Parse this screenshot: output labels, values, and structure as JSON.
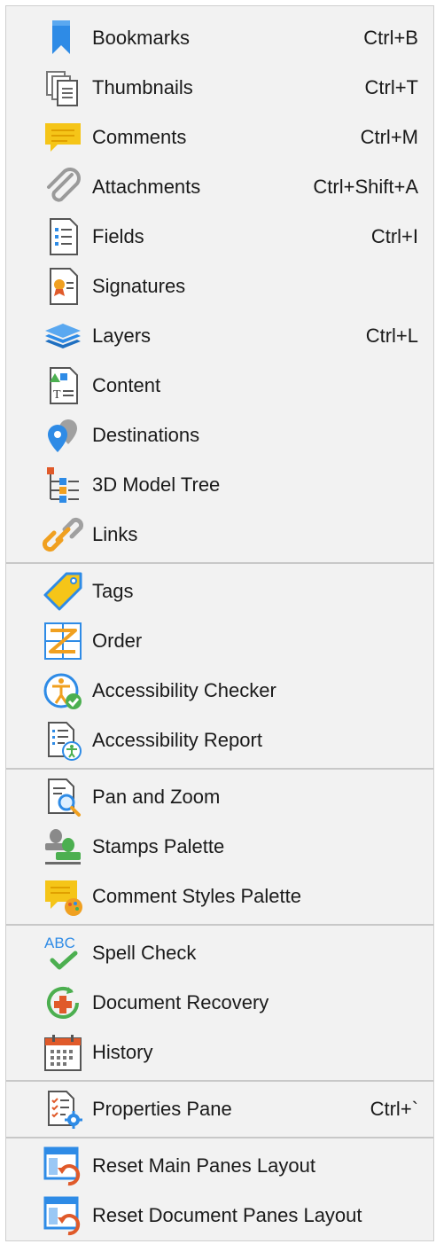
{
  "menu": {
    "items": [
      {
        "label": "Bookmarks",
        "shortcut": "Ctrl+B",
        "icon": "bookmark-icon"
      },
      {
        "label": "Thumbnails",
        "shortcut": "Ctrl+T",
        "icon": "thumbnails-icon"
      },
      {
        "label": "Comments",
        "shortcut": "Ctrl+M",
        "icon": "comment-icon"
      },
      {
        "label": "Attachments",
        "shortcut": "Ctrl+Shift+A",
        "icon": "paperclip-icon"
      },
      {
        "label": "Fields",
        "shortcut": "Ctrl+I",
        "icon": "fields-icon"
      },
      {
        "label": "Signatures",
        "shortcut": "",
        "icon": "signature-icon"
      },
      {
        "label": "Layers",
        "shortcut": "Ctrl+L",
        "icon": "layers-icon"
      },
      {
        "label": "Content",
        "shortcut": "",
        "icon": "content-icon"
      },
      {
        "label": "Destinations",
        "shortcut": "",
        "icon": "destinations-icon"
      },
      {
        "label": "3D Model Tree",
        "shortcut": "",
        "icon": "model-tree-icon"
      },
      {
        "label": "Links",
        "shortcut": "",
        "icon": "links-icon"
      },
      {
        "label": "Tags",
        "shortcut": "",
        "icon": "tag-icon"
      },
      {
        "label": "Order",
        "shortcut": "",
        "icon": "order-icon"
      },
      {
        "label": "Accessibility Checker",
        "shortcut": "",
        "icon": "accessibility-checker-icon"
      },
      {
        "label": "Accessibility Report",
        "shortcut": "",
        "icon": "accessibility-report-icon"
      },
      {
        "label": "Pan and Zoom",
        "shortcut": "",
        "icon": "pan-zoom-icon"
      },
      {
        "label": "Stamps Palette",
        "shortcut": "",
        "icon": "stamps-icon"
      },
      {
        "label": "Comment Styles Palette",
        "shortcut": "",
        "icon": "comment-styles-icon"
      },
      {
        "label": "Spell Check",
        "shortcut": "",
        "icon": "spell-check-icon"
      },
      {
        "label": "Document Recovery",
        "shortcut": "",
        "icon": "document-recovery-icon"
      },
      {
        "label": "History",
        "shortcut": "",
        "icon": "history-icon"
      },
      {
        "label": "Properties Pane",
        "shortcut": "Ctrl+`",
        "icon": "properties-icon"
      },
      {
        "label": "Reset Main Panes Layout",
        "shortcut": "",
        "icon": "reset-layout-icon"
      },
      {
        "label": "Reset Document Panes Layout",
        "shortcut": "",
        "icon": "reset-layout-icon"
      }
    ],
    "spell_check_glyph": "ABC",
    "colors": {
      "background": "#f2f2f2",
      "separator": "#c8c8c8",
      "text": "#1a1a1a",
      "blue": "#2e8be6",
      "yellow": "#f5c518",
      "green": "#4caf50",
      "orange": "#f0a020",
      "red": "#e05a2a"
    }
  }
}
